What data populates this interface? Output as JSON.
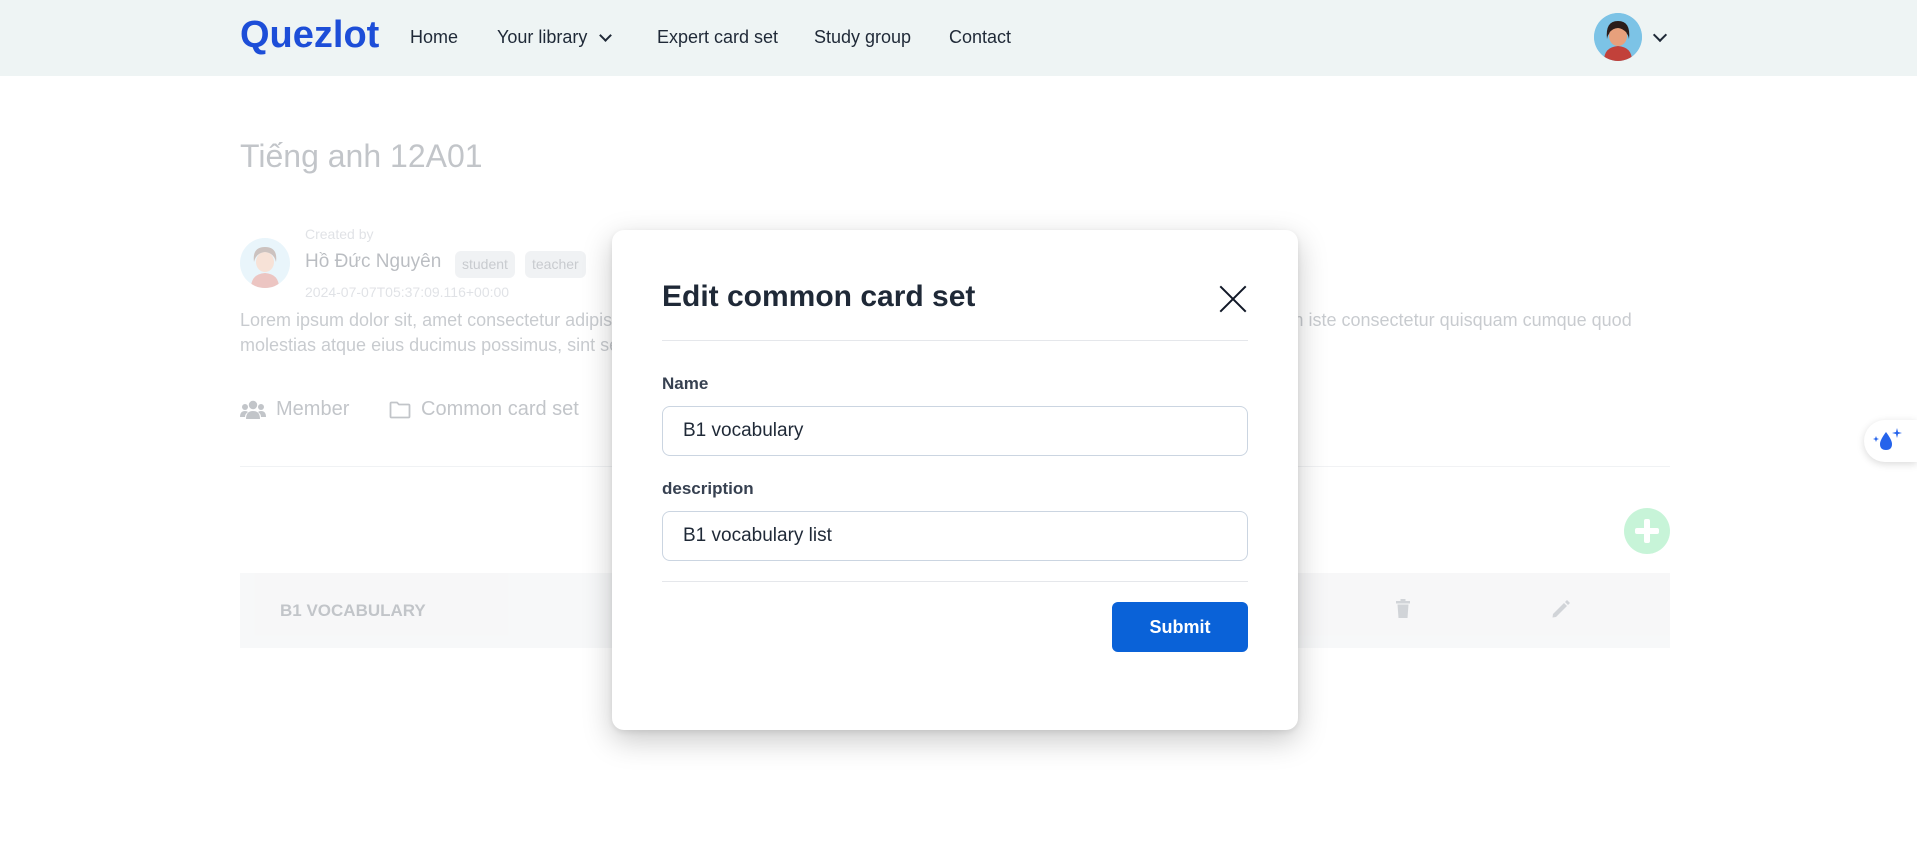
{
  "navbar": {
    "logo": "Quezlot",
    "items": [
      {
        "label": "Home"
      },
      {
        "label": "Your library"
      },
      {
        "label": "Expert card set"
      },
      {
        "label": "Study group"
      },
      {
        "label": "Contact"
      }
    ]
  },
  "group": {
    "title": "Tiếng anh 12A01",
    "created_by_label": "Created by",
    "creator_name": "Hồ Đức Nguyên",
    "tags": [
      "student",
      "teacher"
    ],
    "created_at": "2024-07-07T05:37:09.116+00:00",
    "description_line1": "Lorem ipsum dolor sit, amet consectetur adipisicing elit. Quasi, facilis laboriosam consequuntur accusantium, et fuga ducimus quidem iste consectetur quisquam cumque quod",
    "description_line2": "molestias atque eius ducimus possimus, sint sequi adipisci."
  },
  "tabs": [
    {
      "label": "Member",
      "icon": "users-icon"
    },
    {
      "label": "Common card set",
      "icon": "folder-icon"
    }
  ],
  "card_sets": [
    {
      "name": "B1 VOCABULARY"
    }
  ],
  "modal": {
    "title": "Edit common card set",
    "name_label": "Name",
    "name_value": "B1 vocabulary",
    "description_label": "description",
    "description_value": "B1 vocabulary list",
    "submit_label": "Submit"
  },
  "colors": {
    "brand": "#1d4ed8",
    "submit": "#0a62d8",
    "navbar_bg": "#eef4f4",
    "add_button": "#4ade80"
  }
}
